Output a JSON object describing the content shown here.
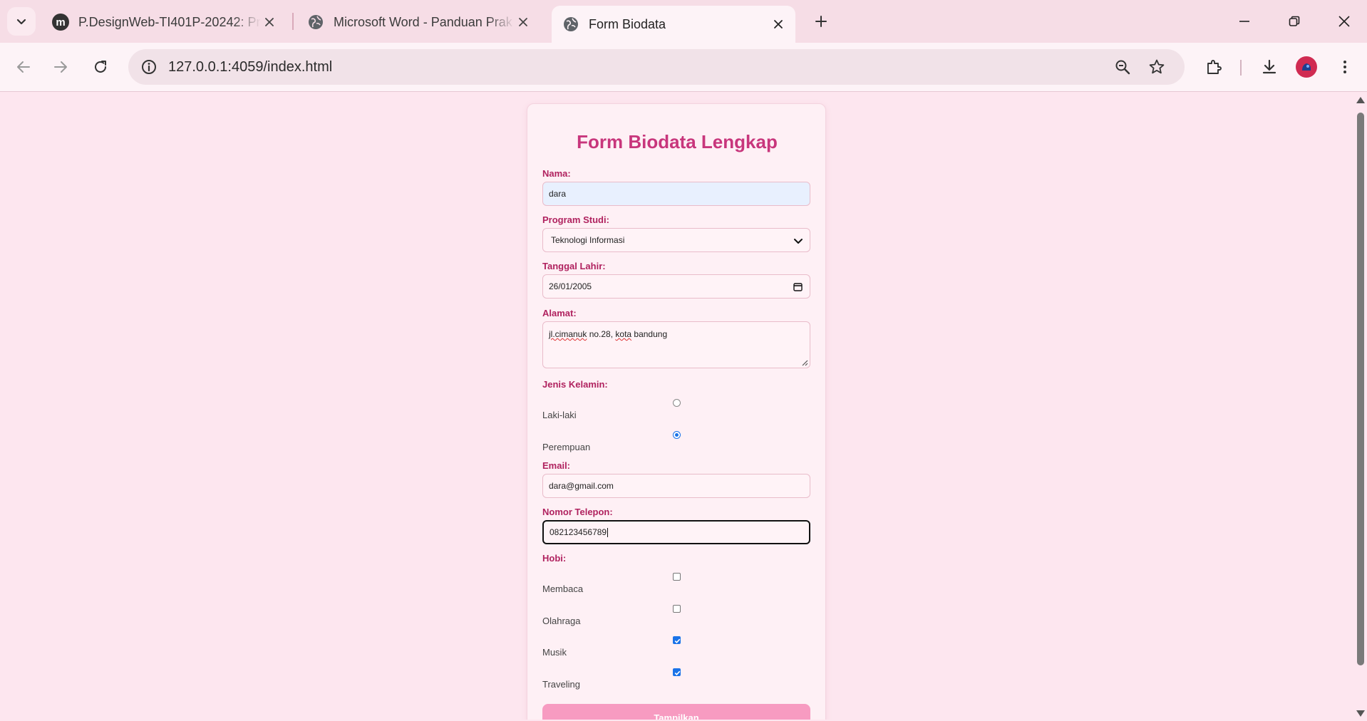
{
  "browser": {
    "tabs": [
      {
        "title": "P.DesignWeb-TI401P-20242: Pr",
        "active": false
      },
      {
        "title": "Microsoft Word - Panduan Prak",
        "active": false
      },
      {
        "title": "Form Biodata",
        "active": true
      }
    ],
    "url": "127.0.0.1:4059/index.html"
  },
  "form": {
    "title": "Form Biodata Lengkap",
    "nama": {
      "label": "Nama:",
      "value": "dara"
    },
    "prodi": {
      "label": "Program Studi:",
      "value": "Teknologi Informasi"
    },
    "tanggal": {
      "label": "Tanggal Lahir:",
      "value": "26/01/2005"
    },
    "alamat": {
      "label": "Alamat:",
      "value_part1": "jl.cimanuk",
      "value_part2": " no.28, ",
      "value_part3": "kota",
      "value_part4": " bandung"
    },
    "gender": {
      "label": "Jenis Kelamin:",
      "options": [
        {
          "label": "Laki-laki",
          "checked": false
        },
        {
          "label": "Perempuan",
          "checked": true
        }
      ]
    },
    "email": {
      "label": "Email:",
      "value": "dara@gmail.com"
    },
    "telepon": {
      "label": "Nomor Telepon:",
      "value": "082123456789"
    },
    "hobi": {
      "label": "Hobi:",
      "options": [
        {
          "label": "Membaca",
          "checked": false
        },
        {
          "label": "Olahraga",
          "checked": false
        },
        {
          "label": "Musik",
          "checked": true
        },
        {
          "label": "Traveling",
          "checked": true
        }
      ]
    },
    "submit_label": "Tampilkan"
  },
  "colors": {
    "accent": "#c8367c",
    "label": "#b0225f",
    "button": "#f79bc1",
    "page_bg": "#fde6ef"
  }
}
